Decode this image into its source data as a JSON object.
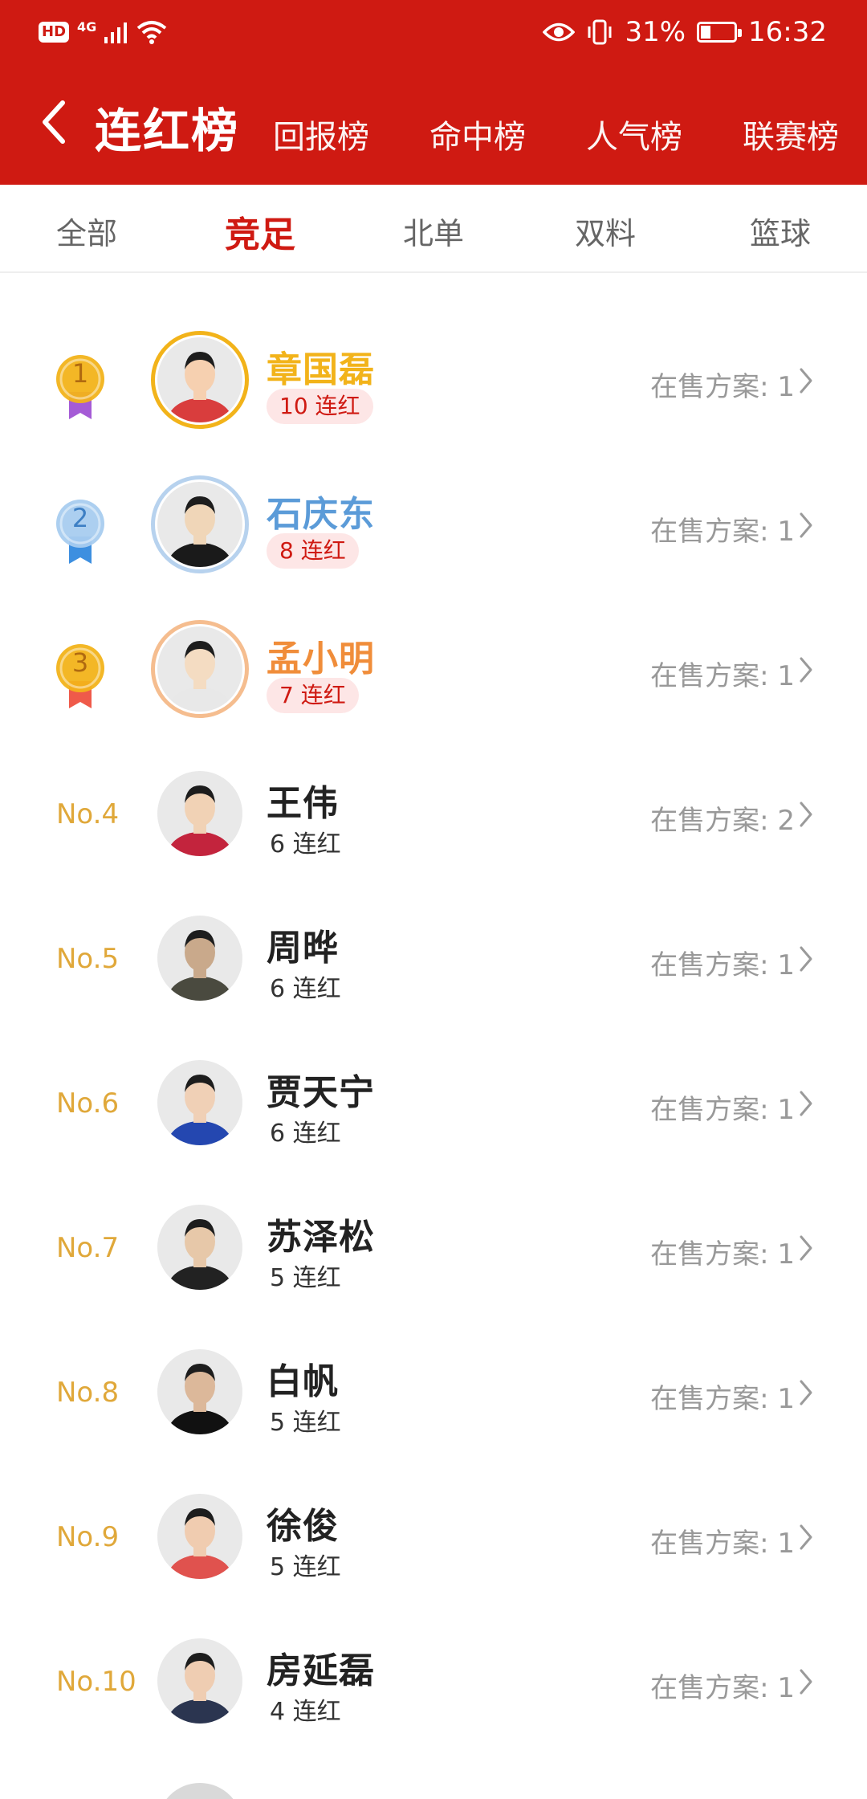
{
  "status": {
    "battery_text": "31%",
    "time": "16:32",
    "network": "4G",
    "hd": "HD",
    "battery_level": 0.31
  },
  "header": {
    "title": "连红榜",
    "tabs": [
      "回报榜",
      "命中榜",
      "人气榜",
      "联赛榜"
    ]
  },
  "subtabs": [
    "全部",
    "竞足",
    "北单",
    "双料",
    "篮球"
  ],
  "active_subtab": "竞足",
  "list": [
    {
      "rank": "1",
      "name": "章国磊",
      "streak": "10 连红",
      "sale_label": "在售方案:",
      "sale_count": "1",
      "medal": "gold"
    },
    {
      "rank": "2",
      "name": "石庆东",
      "streak": "8 连红",
      "sale_label": "在售方案:",
      "sale_count": "1",
      "medal": "silver"
    },
    {
      "rank": "3",
      "name": "孟小明",
      "streak": "7 连红",
      "sale_label": "在售方案:",
      "sale_count": "1",
      "medal": "bronze"
    },
    {
      "rank": "No.4",
      "name": "王伟",
      "streak": "6 连红",
      "sale_label": "在售方案:",
      "sale_count": "2"
    },
    {
      "rank": "No.5",
      "name": "周晔",
      "streak": "6 连红",
      "sale_label": "在售方案:",
      "sale_count": "1"
    },
    {
      "rank": "No.6",
      "name": "贾天宁",
      "streak": "6 连红",
      "sale_label": "在售方案:",
      "sale_count": "1"
    },
    {
      "rank": "No.7",
      "name": "苏泽松",
      "streak": "5 连红",
      "sale_label": "在售方案:",
      "sale_count": "1"
    },
    {
      "rank": "No.8",
      "name": "白帆",
      "streak": "5 连红",
      "sale_label": "在售方案:",
      "sale_count": "1"
    },
    {
      "rank": "No.9",
      "name": "徐俊",
      "streak": "5 连红",
      "sale_label": "在售方案:",
      "sale_count": "1"
    },
    {
      "rank": "No.10",
      "name": "房延磊",
      "streak": "4 连红",
      "sale_label": "在售方案:",
      "sale_count": "1"
    }
  ],
  "colors": {
    "header_bg": "#cf1a12",
    "gold": "#f2b31a",
    "silver": "#5b9bd8",
    "bronze": "#f08d3a",
    "rank_text": "#e0a83a"
  }
}
